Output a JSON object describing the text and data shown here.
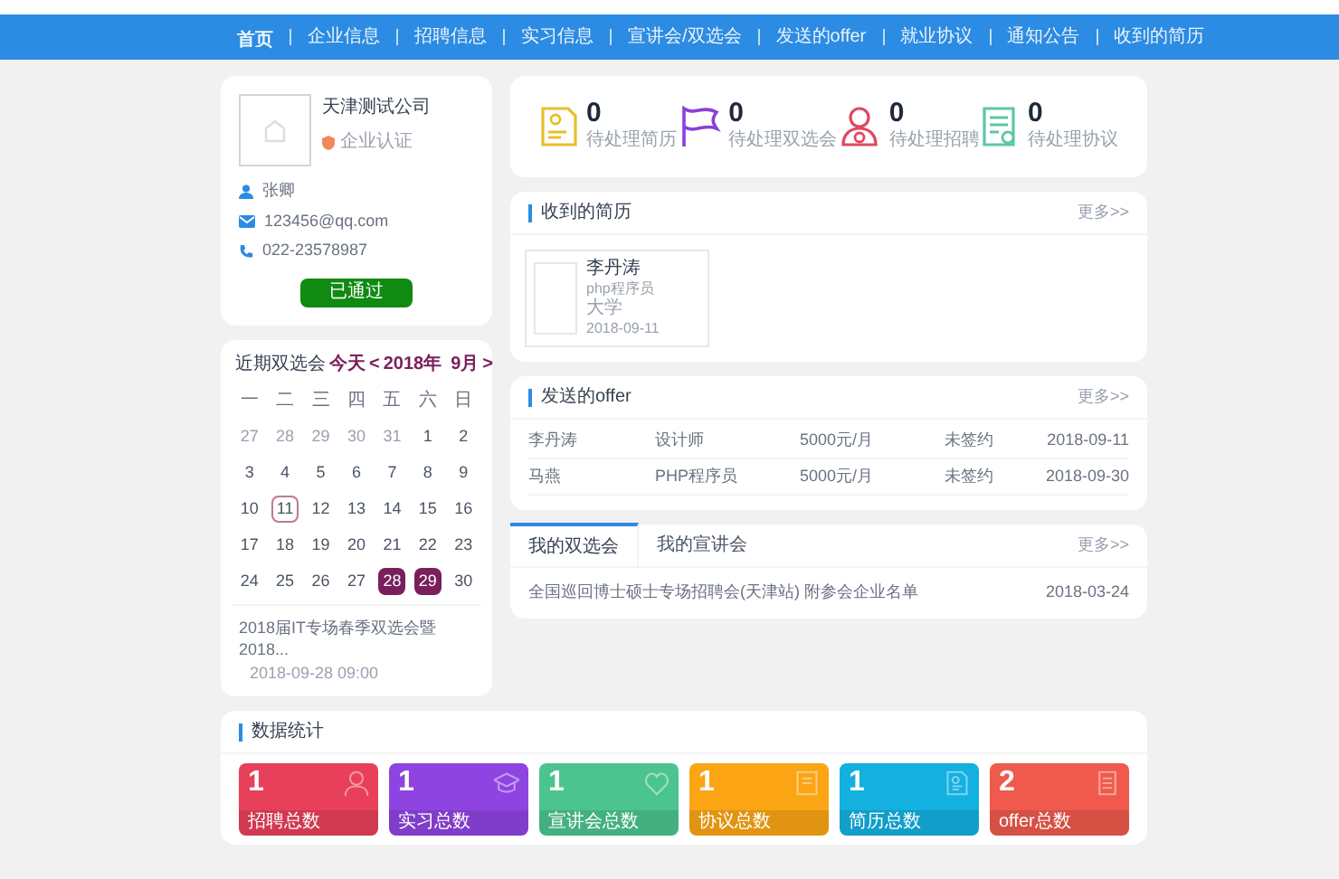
{
  "nav": [
    {
      "label": "首页",
      "selected": true
    },
    {
      "label": "企业信息",
      "selected": false
    },
    {
      "label": "招聘信息",
      "selected": false
    },
    {
      "label": "实习信息",
      "selected": false
    },
    {
      "label": "宣讲会/双选会",
      "selected": false
    },
    {
      "label": "发送的offer",
      "selected": false
    },
    {
      "label": "就业协议",
      "selected": false
    },
    {
      "label": "通知公告",
      "selected": false
    },
    {
      "label": "收到的简历",
      "selected": false
    }
  ],
  "profile": {
    "company": "天津测试公司",
    "certification": "企业认证",
    "contact": "张卿",
    "email": "123456@qq.com",
    "phone": "022-23578987",
    "status_button": "已通过"
  },
  "calendar": {
    "title": "近期双选会",
    "today": "今天",
    "prev": "<",
    "year": "2018年",
    "month": "9月",
    "next": ">",
    "weekdays": [
      "一",
      "二",
      "三",
      "四",
      "五",
      "六",
      "日"
    ],
    "days": [
      {
        "label": "27",
        "kind": "other"
      },
      {
        "label": "28",
        "kind": "other"
      },
      {
        "label": "29",
        "kind": "other"
      },
      {
        "label": "30",
        "kind": "other"
      },
      {
        "label": "31",
        "kind": "other"
      },
      {
        "label": "1",
        "kind": "day"
      },
      {
        "label": "2",
        "kind": "day"
      },
      {
        "label": "3",
        "kind": "day"
      },
      {
        "label": "4",
        "kind": "day"
      },
      {
        "label": "5",
        "kind": "day"
      },
      {
        "label": "6",
        "kind": "day"
      },
      {
        "label": "7",
        "kind": "day"
      },
      {
        "label": "8",
        "kind": "day"
      },
      {
        "label": "9",
        "kind": "day"
      },
      {
        "label": "10",
        "kind": "day"
      },
      {
        "label": "11",
        "kind": "today"
      },
      {
        "label": "12",
        "kind": "day"
      },
      {
        "label": "13",
        "kind": "day"
      },
      {
        "label": "14",
        "kind": "day"
      },
      {
        "label": "15",
        "kind": "day"
      },
      {
        "label": "16",
        "kind": "day"
      },
      {
        "label": "17",
        "kind": "day"
      },
      {
        "label": "18",
        "kind": "day"
      },
      {
        "label": "19",
        "kind": "day"
      },
      {
        "label": "20",
        "kind": "day"
      },
      {
        "label": "21",
        "kind": "day"
      },
      {
        "label": "22",
        "kind": "day"
      },
      {
        "label": "23",
        "kind": "day"
      },
      {
        "label": "24",
        "kind": "day"
      },
      {
        "label": "25",
        "kind": "day"
      },
      {
        "label": "26",
        "kind": "day"
      },
      {
        "label": "27",
        "kind": "day"
      },
      {
        "label": "28",
        "kind": "event"
      },
      {
        "label": "29",
        "kind": "event"
      },
      {
        "label": "30",
        "kind": "day"
      }
    ],
    "events": [
      {
        "title": "2018届IT专场春季双选会暨2018...",
        "time": "2018-09-28 09:00"
      }
    ]
  },
  "pending": [
    {
      "kind": "resume",
      "count": "0",
      "label": "待处理简历"
    },
    {
      "kind": "fair",
      "count": "0",
      "label": "待处理双选会"
    },
    {
      "kind": "hiring",
      "count": "0",
      "label": "待处理招聘"
    },
    {
      "kind": "agreement",
      "count": "0",
      "label": "待处理协议"
    }
  ],
  "resumes": {
    "title": "收到的简历",
    "more": "更多>>",
    "items": [
      {
        "name": "李丹涛",
        "position": "php程序员",
        "education": "大学",
        "date": "2018-09-11"
      }
    ]
  },
  "offers": {
    "title": "发送的offer",
    "more": "更多>>",
    "rows": [
      {
        "name": "李丹涛",
        "position": "设计师",
        "salary": "5000元/月",
        "status": "未签约",
        "date": "2018-09-11"
      },
      {
        "name": "马燕",
        "position": "PHP程序员",
        "salary": "5000元/月",
        "status": "未签约",
        "date": "2018-09-30"
      }
    ]
  },
  "fairs": {
    "tabs": [
      {
        "label": "我的双选会",
        "selected": true
      },
      {
        "label": "我的宣讲会",
        "selected": false
      }
    ],
    "more": "更多>>",
    "rows": [
      {
        "title": "全国巡回博士硕士专场招聘会(天津站) 附参会企业名单",
        "date": "2018-03-24"
      }
    ]
  },
  "stats": {
    "title": "数据统计",
    "tiles": [
      {
        "kind": "person",
        "value": "1",
        "label": "招聘总数",
        "color": "#e8405a"
      },
      {
        "kind": "cap",
        "value": "1",
        "label": "实习总数",
        "color": "#8e44e0"
      },
      {
        "kind": "heart",
        "value": "1",
        "label": "宣讲会总数",
        "color": "#4cc490"
      },
      {
        "kind": "doc",
        "value": "1",
        "label": "协议总数",
        "color": "#fba515"
      },
      {
        "kind": "resume",
        "value": "1",
        "label": "简历总数",
        "color": "#13b0e0"
      },
      {
        "kind": "list",
        "value": "2",
        "label": "offer总数",
        "color": "#ef5a4c"
      }
    ]
  }
}
